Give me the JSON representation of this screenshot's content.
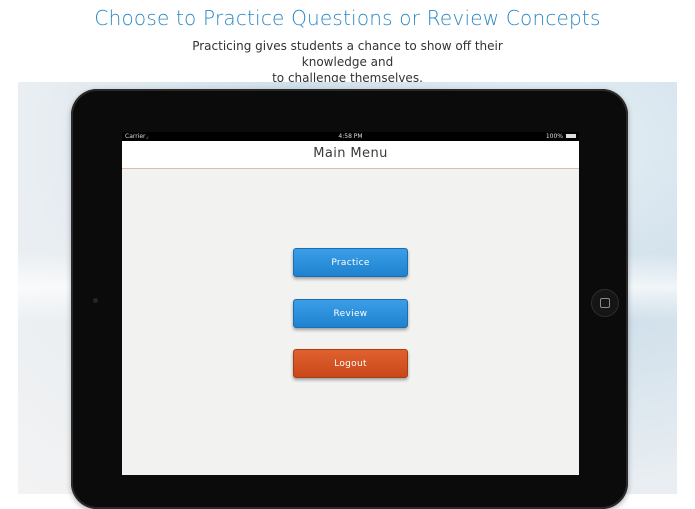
{
  "header": {
    "headline": "Choose to Practice Questions or Review Concepts",
    "subline_1": "Practicing gives students a chance to show off their knowledge and",
    "subline_2": "to challenge themselves."
  },
  "statusbar": {
    "carrier": "Carrier",
    "wifi_icon": "◞",
    "time": "4:58 PM",
    "battery": "100%"
  },
  "navbar": {
    "title": "Main Menu"
  },
  "menu": {
    "practice_label": "Practice",
    "review_label": "Review",
    "logout_label": "Logout"
  },
  "colors": {
    "headline": "#2a87c4",
    "primary_button": "#2a8fdc",
    "logout_button": "#d4541f"
  }
}
